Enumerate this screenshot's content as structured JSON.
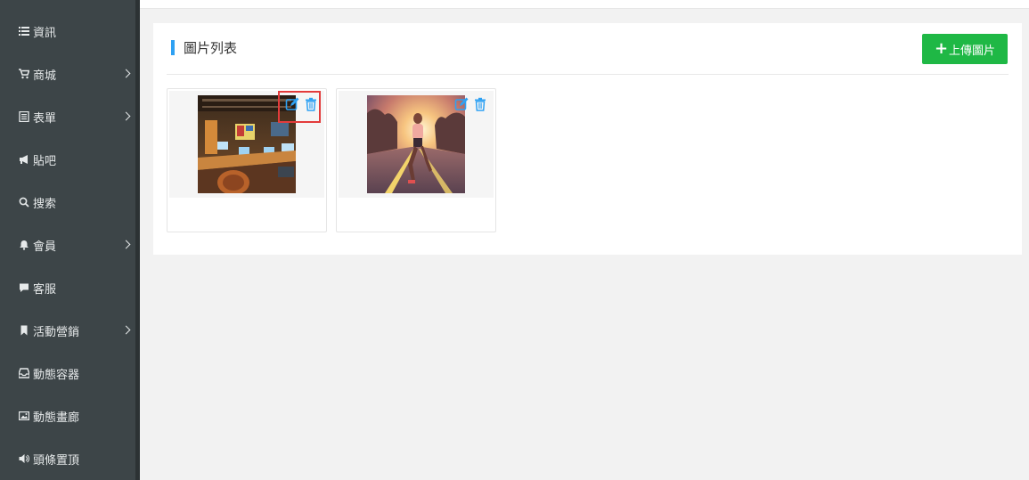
{
  "sidebar": {
    "items": [
      {
        "label": "資訊",
        "icon": "list-icon",
        "has_submenu": false
      },
      {
        "label": "商城",
        "icon": "cart-icon",
        "has_submenu": true
      },
      {
        "label": "表單",
        "icon": "form-icon",
        "has_submenu": true
      },
      {
        "label": "貼吧",
        "icon": "megaphone-icon",
        "has_submenu": false
      },
      {
        "label": "搜索",
        "icon": "search-icon",
        "has_submenu": false
      },
      {
        "label": "會員",
        "icon": "bell-icon",
        "has_submenu": true
      },
      {
        "label": "客服",
        "icon": "comment-icon",
        "has_submenu": false
      },
      {
        "label": "活動營銷",
        "icon": "bookmark-icon",
        "has_submenu": true
      },
      {
        "label": "動態容器",
        "icon": "inbox-icon",
        "has_submenu": false
      },
      {
        "label": "動態畫廊",
        "icon": "picture-icon",
        "has_submenu": false
      },
      {
        "label": "頭條置頂",
        "icon": "speaker-icon",
        "has_submenu": false
      }
    ]
  },
  "panel": {
    "title": "圖片列表",
    "upload_label": "上傳圖片",
    "upload_icon": "plus-icon"
  },
  "images": [
    {
      "subject": "office",
      "actions": [
        "edit-icon",
        "trash-icon"
      ]
    },
    {
      "subject": "runner",
      "actions": [
        "edit-icon",
        "trash-icon"
      ]
    }
  ],
  "colors": {
    "sidebar_bg": "#3d4548",
    "accent": "#2ea1f3",
    "upload_button": "#1fb845",
    "highlight_border": "#e33b3b"
  }
}
